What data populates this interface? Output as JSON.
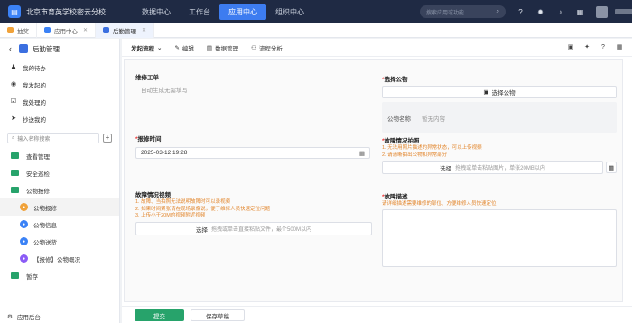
{
  "topbar": {
    "school": "北京市育英学校密云分校",
    "nav": [
      "数据中心",
      "工作台",
      "应用中心",
      "组织中心"
    ],
    "active_nav": 2,
    "search_placeholder": "搜索应用或功能",
    "icons": [
      "help-icon",
      "settings-icon",
      "bell-icon",
      "grid-icon"
    ]
  },
  "tabs": [
    {
      "label": "抽奖",
      "color": "#f0a23a"
    },
    {
      "label": "应用中心",
      "color": "#3b82f6"
    },
    {
      "label": "后勤管理",
      "color": "#3b6fe0"
    }
  ],
  "sidebar": {
    "title": "后勤管理",
    "items": [
      "我的待办",
      "我发起的",
      "我处理的",
      "抄送我的"
    ],
    "search_placeholder": "输入名称搜索",
    "folders": [
      "查看管理",
      "安全巡检",
      "公物报修"
    ],
    "sub_items": [
      {
        "label": "公物报修",
        "color": "#f0a23a",
        "active": true
      },
      {
        "label": "公物信息",
        "color": "#3b82f6"
      },
      {
        "label": "公物送货",
        "color": "#3b82f6"
      },
      {
        "label": "【报修】公物概况",
        "color": "#8b5cf6"
      }
    ],
    "folder_last": "暂存",
    "footer": "应用后台"
  },
  "toolbar": {
    "items": [
      "发起流程",
      "编辑",
      "数据管理",
      "流程分析"
    ]
  },
  "form": {
    "repair_no_label": "维修工单",
    "repair_no_value": "自动生成无需填写",
    "goods_label": "选择公物",
    "goods_button": "选择公物",
    "goods_name_label": "公物名称",
    "goods_name_value": "暂无内容",
    "report_time_label": "报修时间",
    "report_time_value": "2025-03-12 19:28",
    "photo_label": "故障情况拍照",
    "photo_hints": [
      "1. 无法用照片描述的异常状态，可以上传视频",
      "2. 请清晰拍出公物和异常部分"
    ],
    "photo_upload_strong": "选择",
    "photo_upload_text": "拖拽或单击粘贴图片，单张20MB以内",
    "video_label": "故障情况视频",
    "video_hints": [
      "1. 故障、当拍照无法说明故障时可以录视频",
      "2. 如果时间紧张请在现场录像说，便于维修人员快速定位问题",
      "3. 上传小于20M的视频附近视频"
    ],
    "video_upload_strong": "选择",
    "video_upload_text": "拖拽或单击直接粘贴文件，最个500M以内",
    "desc_label": "故障描述",
    "desc_hint": "请详细描述需要维修的部位、方便维修人员快速定位",
    "submit": "提交",
    "save_draft": "保存草稿"
  }
}
